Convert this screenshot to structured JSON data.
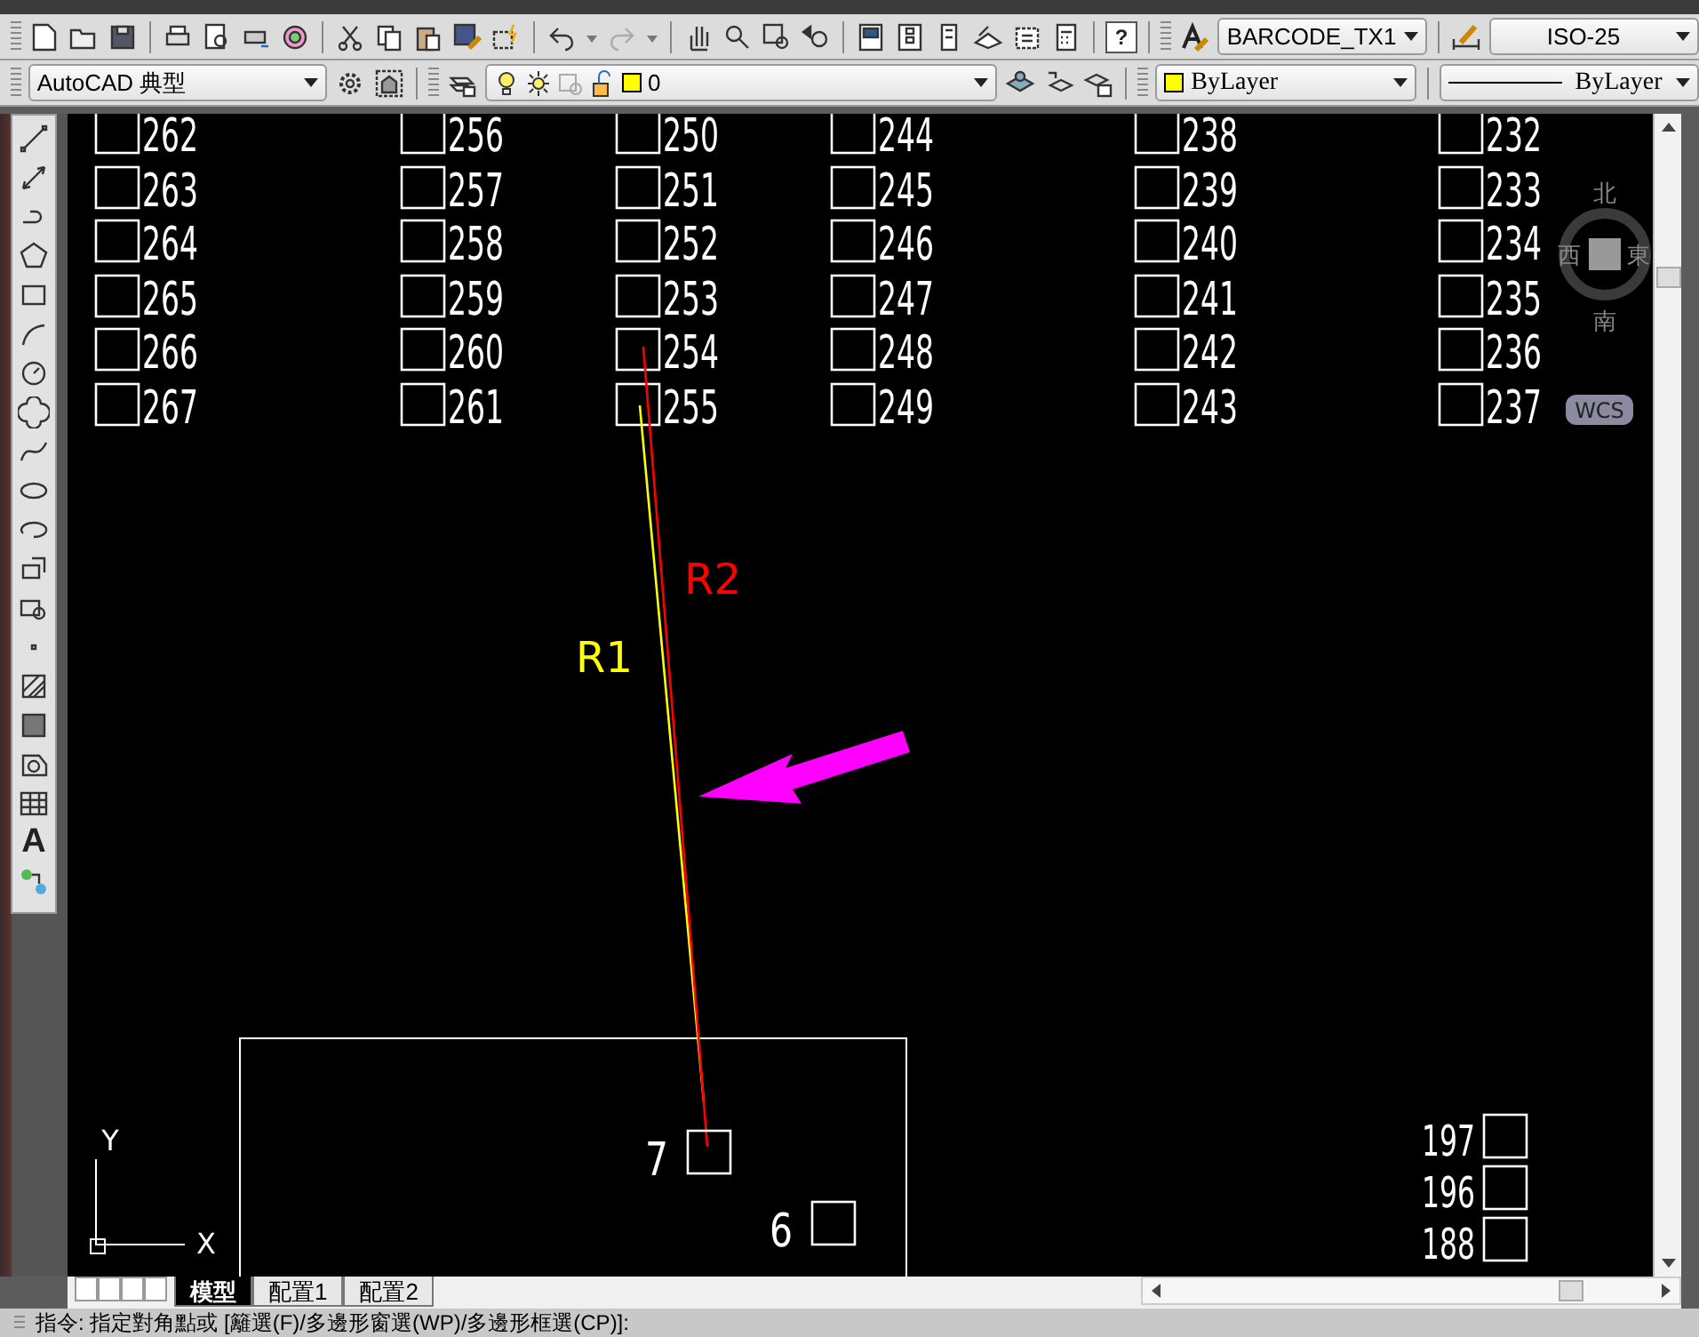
{
  "toolbars": {
    "text_style": "BARCODE_TX1",
    "dim_style": "ISO-25",
    "workspace": "AutoCAD 典型",
    "layer": "0",
    "color_setting": "ByLayer",
    "linetype": "ByLayer",
    "help": "?"
  },
  "draw_tools": {
    "text_tool": "A"
  },
  "drawing": {
    "grid_columns": [
      [
        "262",
        "263",
        "264",
        "265",
        "266",
        "267"
      ],
      [
        "256",
        "257",
        "258",
        "259",
        "260",
        "261"
      ],
      [
        "250",
        "251",
        "252",
        "253",
        "254",
        "255"
      ],
      [
        "244",
        "245",
        "246",
        "247",
        "248",
        "249"
      ],
      [
        "238",
        "239",
        "240",
        "241",
        "242",
        "243"
      ],
      [
        "232",
        "233",
        "234",
        "235",
        "236",
        "237"
      ]
    ],
    "markers": [
      {
        "label": "R1",
        "color": "#ffff00"
      },
      {
        "label": "R2",
        "color": "#ff0000"
      }
    ],
    "near_labels": [
      "7",
      "6"
    ],
    "corner_labels": [
      "197",
      "196",
      "188"
    ],
    "ucs": {
      "y": "Y",
      "x": "X"
    },
    "viewcube": {
      "north": "北",
      "west": "西",
      "east": "東",
      "south": "南",
      "badge": "WCS"
    }
  },
  "tabs": [
    {
      "label": "模型",
      "selected": true
    },
    {
      "label": "配置1",
      "selected": false
    },
    {
      "label": "配置2",
      "selected": false
    }
  ],
  "command": "指令: 指定對角點或 [籬選(F)/多邊形窗選(WP)/多邊形框選(CP)]:"
}
